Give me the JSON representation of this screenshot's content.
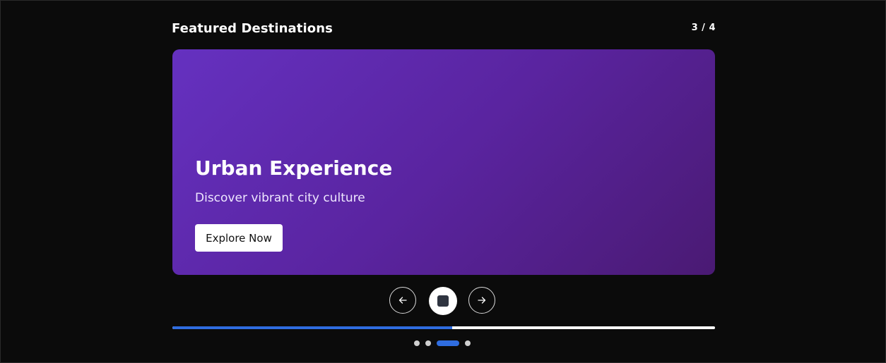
{
  "header": {
    "title": "Featured Destinations",
    "counter": "3 / 4"
  },
  "slide": {
    "title": "Urban Experience",
    "subtitle": "Discover vibrant city culture",
    "cta_label": "Explore Now",
    "gradient_colors": [
      "#6531c0",
      "#4a1a73"
    ]
  },
  "controls": {
    "prev_icon": "arrow-left-icon",
    "pause_icon": "stop-icon",
    "next_icon": "arrow-right-icon"
  },
  "progress": {
    "fraction": 0.515,
    "fill_color": "#2f6de0",
    "track_color": "#ffffff"
  },
  "pagination": {
    "total": 4,
    "active_index": 2
  }
}
